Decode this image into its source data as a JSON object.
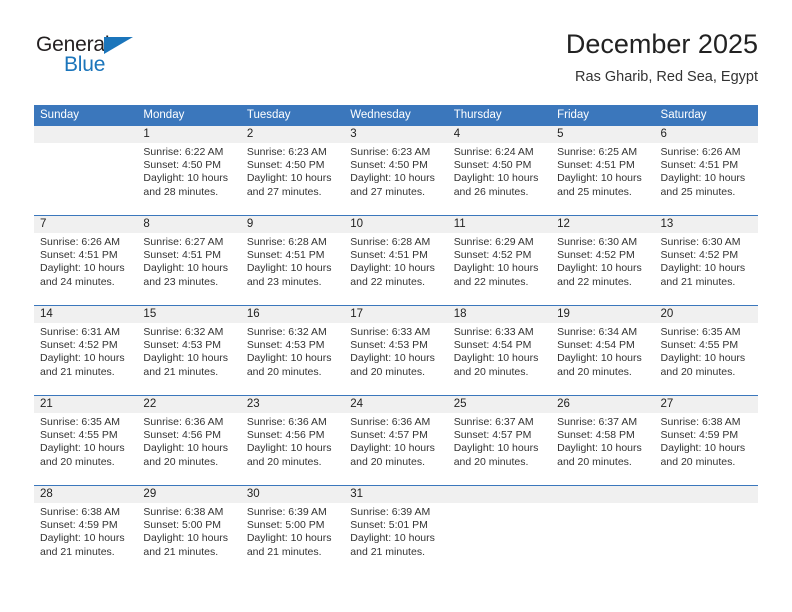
{
  "logo": {
    "word1": "General",
    "word2": "Blue",
    "triangle_color": "#1b75bb",
    "word1_color": "#231f20",
    "word2_color": "#1b75bb"
  },
  "header": {
    "title": "December 2025",
    "subtitle": "Ras Gharib, Red Sea, Egypt"
  },
  "theme": {
    "header_bg": "#3b77bc",
    "header_text": "#ffffff",
    "daynum_band_bg": "#f0f0f0",
    "row_divider": "#3b77bc",
    "body_text": "#333333"
  },
  "calendar": {
    "weekday_headers": [
      "Sunday",
      "Monday",
      "Tuesday",
      "Wednesday",
      "Thursday",
      "Friday",
      "Saturday"
    ],
    "weeks": [
      [
        {
          "day": "",
          "sunrise": "",
          "sunset": "",
          "daylight1": "",
          "daylight2": "",
          "empty": true
        },
        {
          "day": "1",
          "sunrise": "Sunrise: 6:22 AM",
          "sunset": "Sunset: 4:50 PM",
          "daylight1": "Daylight: 10 hours",
          "daylight2": "and 28 minutes."
        },
        {
          "day": "2",
          "sunrise": "Sunrise: 6:23 AM",
          "sunset": "Sunset: 4:50 PM",
          "daylight1": "Daylight: 10 hours",
          "daylight2": "and 27 minutes."
        },
        {
          "day": "3",
          "sunrise": "Sunrise: 6:23 AM",
          "sunset": "Sunset: 4:50 PM",
          "daylight1": "Daylight: 10 hours",
          "daylight2": "and 27 minutes."
        },
        {
          "day": "4",
          "sunrise": "Sunrise: 6:24 AM",
          "sunset": "Sunset: 4:50 PM",
          "daylight1": "Daylight: 10 hours",
          "daylight2": "and 26 minutes."
        },
        {
          "day": "5",
          "sunrise": "Sunrise: 6:25 AM",
          "sunset": "Sunset: 4:51 PM",
          "daylight1": "Daylight: 10 hours",
          "daylight2": "and 25 minutes."
        },
        {
          "day": "6",
          "sunrise": "Sunrise: 6:26 AM",
          "sunset": "Sunset: 4:51 PM",
          "daylight1": "Daylight: 10 hours",
          "daylight2": "and 25 minutes."
        }
      ],
      [
        {
          "day": "7",
          "sunrise": "Sunrise: 6:26 AM",
          "sunset": "Sunset: 4:51 PM",
          "daylight1": "Daylight: 10 hours",
          "daylight2": "and 24 minutes."
        },
        {
          "day": "8",
          "sunrise": "Sunrise: 6:27 AM",
          "sunset": "Sunset: 4:51 PM",
          "daylight1": "Daylight: 10 hours",
          "daylight2": "and 23 minutes."
        },
        {
          "day": "9",
          "sunrise": "Sunrise: 6:28 AM",
          "sunset": "Sunset: 4:51 PM",
          "daylight1": "Daylight: 10 hours",
          "daylight2": "and 23 minutes."
        },
        {
          "day": "10",
          "sunrise": "Sunrise: 6:28 AM",
          "sunset": "Sunset: 4:51 PM",
          "daylight1": "Daylight: 10 hours",
          "daylight2": "and 22 minutes."
        },
        {
          "day": "11",
          "sunrise": "Sunrise: 6:29 AM",
          "sunset": "Sunset: 4:52 PM",
          "daylight1": "Daylight: 10 hours",
          "daylight2": "and 22 minutes."
        },
        {
          "day": "12",
          "sunrise": "Sunrise: 6:30 AM",
          "sunset": "Sunset: 4:52 PM",
          "daylight1": "Daylight: 10 hours",
          "daylight2": "and 22 minutes."
        },
        {
          "day": "13",
          "sunrise": "Sunrise: 6:30 AM",
          "sunset": "Sunset: 4:52 PM",
          "daylight1": "Daylight: 10 hours",
          "daylight2": "and 21 minutes."
        }
      ],
      [
        {
          "day": "14",
          "sunrise": "Sunrise: 6:31 AM",
          "sunset": "Sunset: 4:52 PM",
          "daylight1": "Daylight: 10 hours",
          "daylight2": "and 21 minutes."
        },
        {
          "day": "15",
          "sunrise": "Sunrise: 6:32 AM",
          "sunset": "Sunset: 4:53 PM",
          "daylight1": "Daylight: 10 hours",
          "daylight2": "and 21 minutes."
        },
        {
          "day": "16",
          "sunrise": "Sunrise: 6:32 AM",
          "sunset": "Sunset: 4:53 PM",
          "daylight1": "Daylight: 10 hours",
          "daylight2": "and 20 minutes."
        },
        {
          "day": "17",
          "sunrise": "Sunrise: 6:33 AM",
          "sunset": "Sunset: 4:53 PM",
          "daylight1": "Daylight: 10 hours",
          "daylight2": "and 20 minutes."
        },
        {
          "day": "18",
          "sunrise": "Sunrise: 6:33 AM",
          "sunset": "Sunset: 4:54 PM",
          "daylight1": "Daylight: 10 hours",
          "daylight2": "and 20 minutes."
        },
        {
          "day": "19",
          "sunrise": "Sunrise: 6:34 AM",
          "sunset": "Sunset: 4:54 PM",
          "daylight1": "Daylight: 10 hours",
          "daylight2": "and 20 minutes."
        },
        {
          "day": "20",
          "sunrise": "Sunrise: 6:35 AM",
          "sunset": "Sunset: 4:55 PM",
          "daylight1": "Daylight: 10 hours",
          "daylight2": "and 20 minutes."
        }
      ],
      [
        {
          "day": "21",
          "sunrise": "Sunrise: 6:35 AM",
          "sunset": "Sunset: 4:55 PM",
          "daylight1": "Daylight: 10 hours",
          "daylight2": "and 20 minutes."
        },
        {
          "day": "22",
          "sunrise": "Sunrise: 6:36 AM",
          "sunset": "Sunset: 4:56 PM",
          "daylight1": "Daylight: 10 hours",
          "daylight2": "and 20 minutes."
        },
        {
          "day": "23",
          "sunrise": "Sunrise: 6:36 AM",
          "sunset": "Sunset: 4:56 PM",
          "daylight1": "Daylight: 10 hours",
          "daylight2": "and 20 minutes."
        },
        {
          "day": "24",
          "sunrise": "Sunrise: 6:36 AM",
          "sunset": "Sunset: 4:57 PM",
          "daylight1": "Daylight: 10 hours",
          "daylight2": "and 20 minutes."
        },
        {
          "day": "25",
          "sunrise": "Sunrise: 6:37 AM",
          "sunset": "Sunset: 4:57 PM",
          "daylight1": "Daylight: 10 hours",
          "daylight2": "and 20 minutes."
        },
        {
          "day": "26",
          "sunrise": "Sunrise: 6:37 AM",
          "sunset": "Sunset: 4:58 PM",
          "daylight1": "Daylight: 10 hours",
          "daylight2": "and 20 minutes."
        },
        {
          "day": "27",
          "sunrise": "Sunrise: 6:38 AM",
          "sunset": "Sunset: 4:59 PM",
          "daylight1": "Daylight: 10 hours",
          "daylight2": "and 20 minutes."
        }
      ],
      [
        {
          "day": "28",
          "sunrise": "Sunrise: 6:38 AM",
          "sunset": "Sunset: 4:59 PM",
          "daylight1": "Daylight: 10 hours",
          "daylight2": "and 21 minutes."
        },
        {
          "day": "29",
          "sunrise": "Sunrise: 6:38 AM",
          "sunset": "Sunset: 5:00 PM",
          "daylight1": "Daylight: 10 hours",
          "daylight2": "and 21 minutes."
        },
        {
          "day": "30",
          "sunrise": "Sunrise: 6:39 AM",
          "sunset": "Sunset: 5:00 PM",
          "daylight1": "Daylight: 10 hours",
          "daylight2": "and 21 minutes."
        },
        {
          "day": "31",
          "sunrise": "Sunrise: 6:39 AM",
          "sunset": "Sunset: 5:01 PM",
          "daylight1": "Daylight: 10 hours",
          "daylight2": "and 21 minutes."
        },
        {
          "day": "",
          "sunrise": "",
          "sunset": "",
          "daylight1": "",
          "daylight2": "",
          "empty": true
        },
        {
          "day": "",
          "sunrise": "",
          "sunset": "",
          "daylight1": "",
          "daylight2": "",
          "empty": true
        },
        {
          "day": "",
          "sunrise": "",
          "sunset": "",
          "daylight1": "",
          "daylight2": "",
          "empty": true
        }
      ]
    ]
  }
}
